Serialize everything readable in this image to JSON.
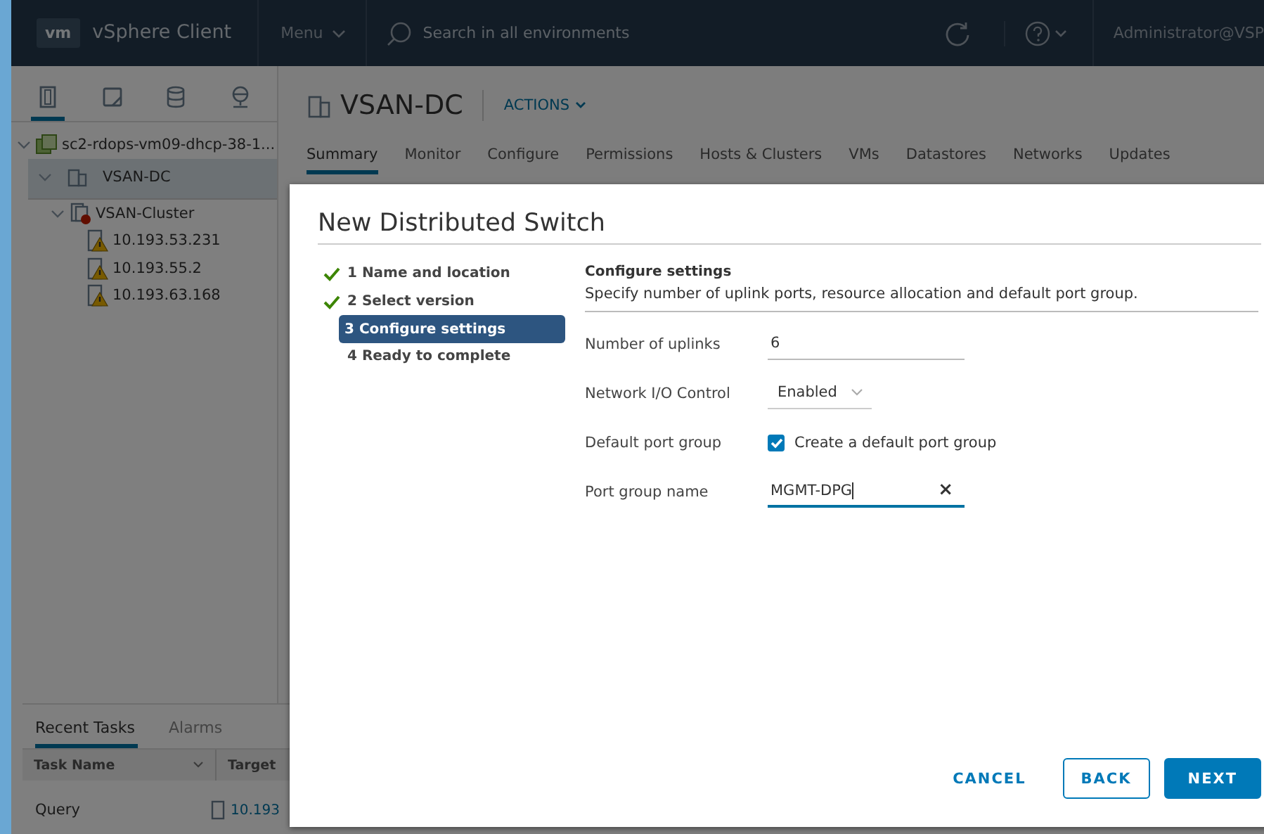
{
  "header": {
    "logo": "vm",
    "app_name": "vSphere Client",
    "menu": "Menu",
    "search": {
      "placeholder": "Search in all environments"
    },
    "user": "Administrator@VSP"
  },
  "sidebar": {
    "view_tabs": [
      {
        "kind": "hosts",
        "selected": true
      },
      {
        "kind": "vms",
        "selected": false
      },
      {
        "kind": "storage",
        "selected": false
      },
      {
        "kind": "network",
        "selected": false
      }
    ],
    "tree": [
      {
        "label": "sc2-rdops-vm09-dhcp-38-1...",
        "kind": "vcenter",
        "expanded": true,
        "selected": false,
        "children": [
          {
            "label": "VSAN-DC",
            "kind": "datacenter",
            "expanded": true,
            "selected": true,
            "children": [
              {
                "label": "VSAN-Cluster",
                "kind": "cluster",
                "expanded": true,
                "selected": false,
                "children": [
                  {
                    "label": "10.193.53.231",
                    "kind": "host",
                    "selected": false
                  },
                  {
                    "label": "10.193.55.2",
                    "kind": "host",
                    "selected": false
                  },
                  {
                    "label": "10.193.63.168",
                    "kind": "host",
                    "selected": false
                  }
                ]
              }
            ]
          }
        ]
      }
    ]
  },
  "object": {
    "title": "VSAN-DC",
    "actions": "ACTIONS",
    "tabs": [
      {
        "label": "Summary",
        "selected": true
      },
      {
        "label": "Monitor",
        "selected": false
      },
      {
        "label": "Configure",
        "selected": false
      },
      {
        "label": "Permissions",
        "selected": false
      },
      {
        "label": "Hosts & Clusters",
        "selected": false
      },
      {
        "label": "VMs",
        "selected": false
      },
      {
        "label": "Datastores",
        "selected": false
      },
      {
        "label": "Networks",
        "selected": false
      },
      {
        "label": "Updates",
        "selected": false
      }
    ]
  },
  "recent_tasks": {
    "tabs": [
      {
        "label": "Recent Tasks",
        "selected": true
      },
      {
        "label": "Alarms",
        "selected": false
      }
    ],
    "columns": [
      "Task Name",
      "Target"
    ],
    "rows": [
      {
        "task_name": "Query",
        "target": "10.193"
      }
    ]
  },
  "dialog": {
    "title": "New Distributed Switch",
    "steps": [
      {
        "label": "1 Name and location",
        "completed": true,
        "selected": false
      },
      {
        "label": "2 Select version",
        "completed": true,
        "selected": false
      },
      {
        "label": "3 Configure settings",
        "completed": false,
        "selected": true
      },
      {
        "label": "4 Ready to complete",
        "completed": false,
        "selected": false
      }
    ],
    "section_title": "Configure settings",
    "description": "Specify number of uplink ports, resource allocation and default port group.",
    "fields": [
      {
        "kind": "text",
        "label": "Number of uplinks",
        "value": "6",
        "focused": false
      },
      {
        "kind": "select",
        "label": "Network I/O Control",
        "value": "Enabled"
      },
      {
        "kind": "checkbox",
        "label": "Default port group",
        "text": "Create a default port group",
        "checked": true
      },
      {
        "kind": "text",
        "label": "Port group name",
        "value": "MGMT-DPG",
        "focused": true,
        "clear": "×"
      }
    ],
    "buttons": [
      {
        "label": "CANCEL",
        "kind": "link"
      },
      {
        "label": "BACK",
        "kind": "outline"
      },
      {
        "label": "NEXT",
        "kind": "primary"
      }
    ]
  }
}
